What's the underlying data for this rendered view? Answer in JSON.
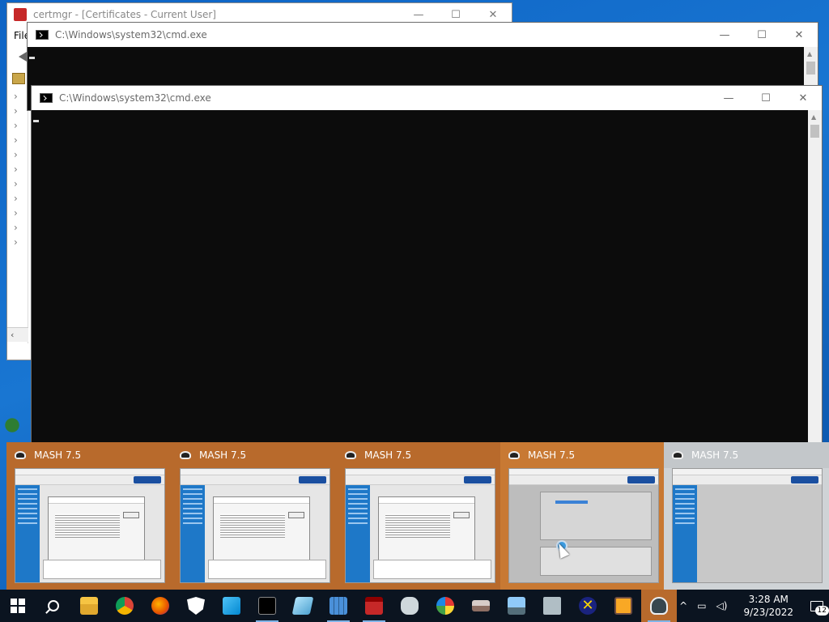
{
  "certmgr": {
    "title": "certmgr - [Certificates - Current User]",
    "menu_first": "File"
  },
  "cmd_back": {
    "title": "C:\\Windows\\system32\\cmd.exe"
  },
  "cmd_front": {
    "title": "C:\\Windows\\system32\\cmd.exe"
  },
  "caption": {
    "minimize": "—",
    "maximize": "☐",
    "close": "✕"
  },
  "thumbnails": [
    {
      "title": "MASH 7.5"
    },
    {
      "title": "MASH 7.5"
    },
    {
      "title": "MASH 7.5"
    },
    {
      "title": "MASH 7.5"
    },
    {
      "title": "MASH 7.5"
    }
  ],
  "taskbar": {
    "icons": [
      "windows-start-icon",
      "search-icon",
      "file-explorer-icon",
      "chrome-icon",
      "firefox-icon",
      "security-shield-icon",
      "photos-icon",
      "cmd-icon",
      "app-icon",
      "calculator-icon",
      "toolbox-icon",
      "hands-icon",
      "paint-icon",
      "scanner-icon",
      "computer-icon",
      "network-icon",
      "x-app-icon",
      "media-icon",
      "mash-icon"
    ],
    "accent_color": "#b86a2c"
  },
  "tray": {
    "time": "3:28 AM",
    "date": "9/23/2022",
    "notification_count": "12",
    "chevron": "^"
  }
}
